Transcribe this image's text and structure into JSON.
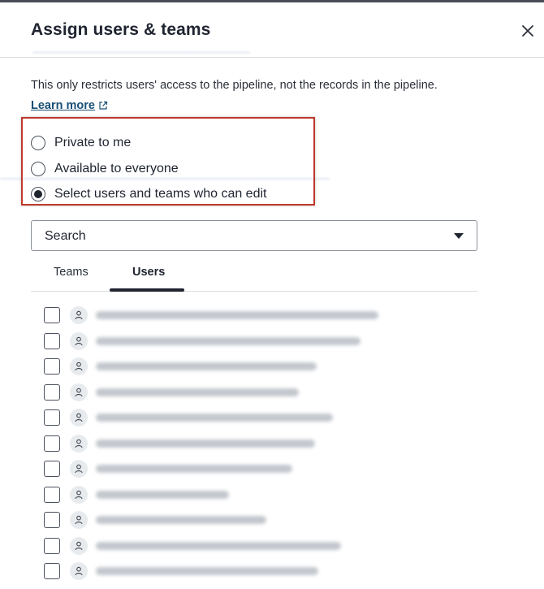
{
  "dialog": {
    "title": "Assign users & teams",
    "close_icon": "close-icon"
  },
  "description": "This only restricts users' access to the pipeline, not the records in the pipeline.",
  "learn_more": {
    "label": "Learn more",
    "icon": "external-link-icon"
  },
  "access_options": [
    {
      "label": "Private to me",
      "selected": false
    },
    {
      "label": "Available to everyone",
      "selected": false
    },
    {
      "label": "Select users and teams who can edit",
      "selected": true
    }
  ],
  "search": {
    "label": "Search",
    "icon": "chevron-down-icon"
  },
  "tabs": [
    {
      "label": "Teams",
      "active": false
    },
    {
      "label": "Users",
      "active": true
    }
  ],
  "colors": {
    "highlight_border": "#c0392b",
    "link": "#1a4f74",
    "text": "#1f2430"
  }
}
